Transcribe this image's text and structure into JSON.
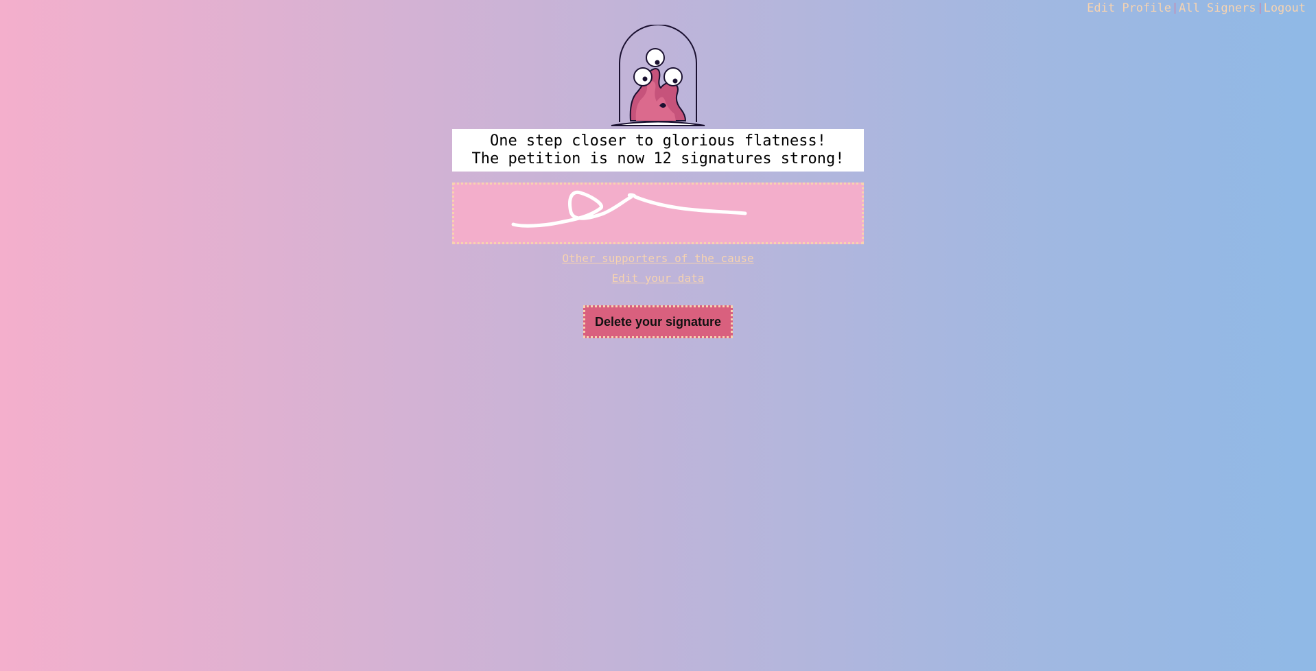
{
  "nav": {
    "edit_profile": "Edit Profile",
    "all_signers": "All Signers",
    "logout": "Logout"
  },
  "message": {
    "line1": "One step closer to glorious flatness!",
    "line2": "The petition is now 12 signatures strong!",
    "signature_count": 12
  },
  "links": {
    "supporters": "Other supporters of the cause",
    "edit_data": "Edit your data"
  },
  "actions": {
    "delete_signature": "Delete your signature"
  },
  "colors": {
    "link": "#f7d3b0",
    "signature_bg": "#f3aecb",
    "delete_button": "#d9607e",
    "gradient_left": "#f4afcc",
    "gradient_right": "#8fb9e6"
  },
  "icons": {
    "logo": "alien-in-jar-icon"
  }
}
